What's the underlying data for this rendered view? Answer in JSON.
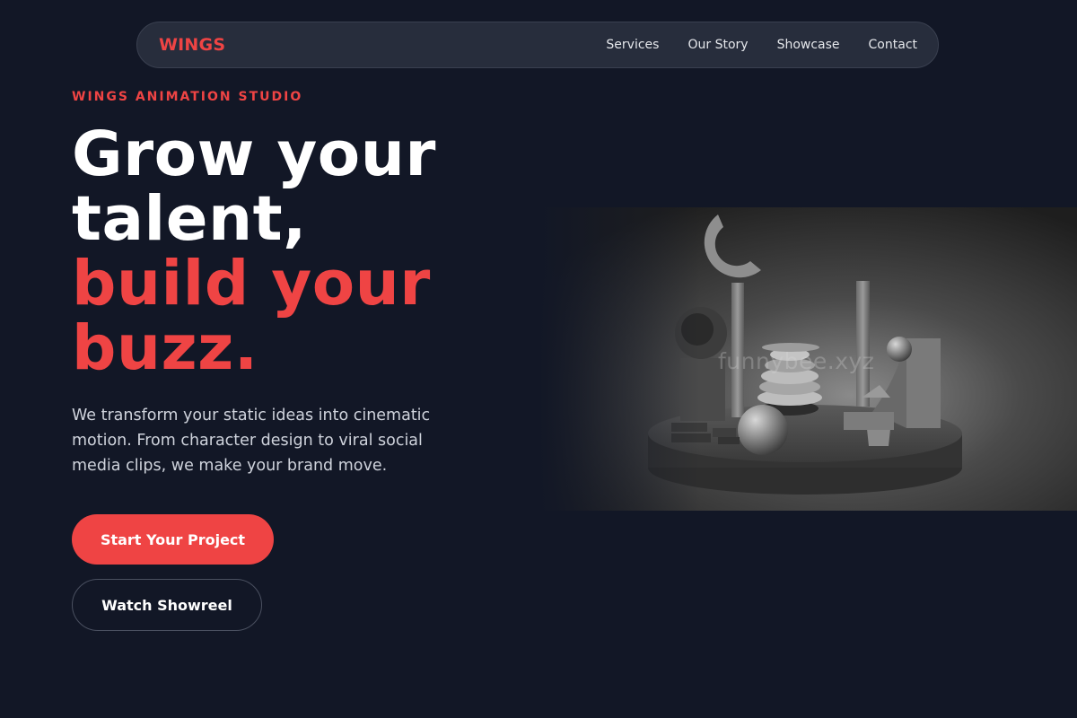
{
  "nav": {
    "brand": "WINGS",
    "links": [
      {
        "label": "Services"
      },
      {
        "label": "Our Story"
      },
      {
        "label": "Showcase"
      },
      {
        "label": "Contact"
      }
    ]
  },
  "hero": {
    "eyebrow": "WINGS ANIMATION STUDIO",
    "headline": {
      "line1": "Grow your",
      "line2": "talent,",
      "line3": "build your",
      "line4": "buzz."
    },
    "description": "We transform your static ideas into cinematic motion. From character design to viral social media clips, we make your brand move.",
    "primary_cta": "Start Your Project",
    "secondary_cta": "Watch Showreel",
    "image_watermark": "funnybee.xyz"
  },
  "colors": {
    "background": "#121726",
    "accent": "#ef4444",
    "nav_background": "#272d3c",
    "text": "#ffffff",
    "muted_text": "#cfd3dc"
  }
}
